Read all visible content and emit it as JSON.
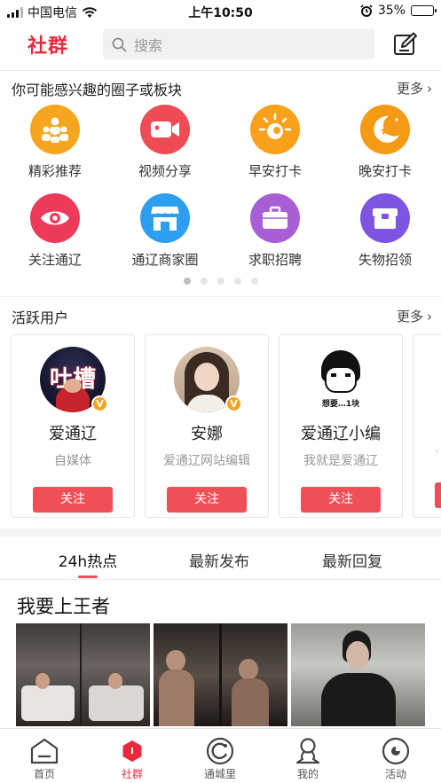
{
  "status_bar": {
    "carrier": "中国电信",
    "time": "上午10:50",
    "battery": "35%",
    "battery_level": 0.35
  },
  "header": {
    "logo": "社群",
    "search_placeholder": "搜索"
  },
  "circles": {
    "title": "你可能感兴趣的圈子或板块",
    "more": "更多",
    "items": [
      {
        "label": "精彩推荐",
        "icon": "people-icon",
        "color": "#f7a51f"
      },
      {
        "label": "视频分享",
        "icon": "video-camera-icon",
        "color": "#ef4b55"
      },
      {
        "label": "早安打卡",
        "icon": "sun-icon",
        "color": "#f9a11b"
      },
      {
        "label": "晚安打卡",
        "icon": "moon-icon",
        "color": "#f59a14"
      },
      {
        "label": "关注通辽",
        "icon": "eye-icon",
        "color": "#ed3a5b"
      },
      {
        "label": "通辽商家圈",
        "icon": "shop-icon",
        "color": "#2e9ef0"
      },
      {
        "label": "求职招聘",
        "icon": "briefcase-icon",
        "color": "#a85fd6"
      },
      {
        "label": "失物招领",
        "icon": "box-icon",
        "color": "#7e55e0"
      }
    ],
    "page_count": 5,
    "active_page": 1
  },
  "active_users": {
    "title": "活跃用户",
    "more": "更多",
    "users": [
      {
        "name": "爱通辽",
        "desc": "自媒体",
        "follow": "关注",
        "avatar_text": "吐槽",
        "verified": "V"
      },
      {
        "name": "安娜",
        "desc": "爱通辽网站编辑",
        "follow": "关注",
        "verified": "V"
      },
      {
        "name": "爱通辽小编",
        "desc": "我就是爱通辽",
        "follow": "关注",
        "avatar_text": "想要…1块"
      }
    ]
  },
  "tabs": [
    {
      "label": "24h热点",
      "active": true
    },
    {
      "label": "最新发布",
      "active": false
    },
    {
      "label": "最新回复",
      "active": false
    }
  ],
  "post": {
    "title": "我要上王者"
  },
  "bottom_nav": [
    {
      "label": "首页",
      "icon": "home-icon"
    },
    {
      "label": "社群",
      "icon": "community-icon",
      "active": true
    },
    {
      "label": "通城里",
      "icon": "city-icon"
    },
    {
      "label": "我的",
      "icon": "profile-icon"
    },
    {
      "label": "活动",
      "icon": "activity-icon"
    }
  ]
}
